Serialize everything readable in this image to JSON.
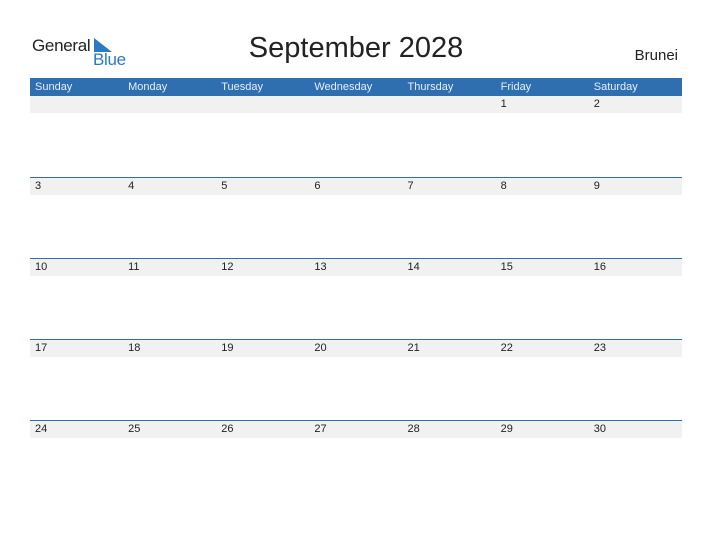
{
  "logo": {
    "word1": "General",
    "word2": "Blue"
  },
  "title": "September 2028",
  "country": "Brunei",
  "weekdays": [
    "Sunday",
    "Monday",
    "Tuesday",
    "Wednesday",
    "Thursday",
    "Friday",
    "Saturday"
  ],
  "weeks": [
    [
      "",
      "",
      "",
      "",
      "",
      "1",
      "2"
    ],
    [
      "3",
      "4",
      "5",
      "6",
      "7",
      "8",
      "9"
    ],
    [
      "10",
      "11",
      "12",
      "13",
      "14",
      "15",
      "16"
    ],
    [
      "17",
      "18",
      "19",
      "20",
      "21",
      "22",
      "23"
    ],
    [
      "24",
      "25",
      "26",
      "27",
      "28",
      "29",
      "30"
    ]
  ],
  "colors": {
    "accent": "#2f6fb0",
    "logo_blue": "#2a7bc4",
    "date_strip": "#f1f1f1"
  }
}
